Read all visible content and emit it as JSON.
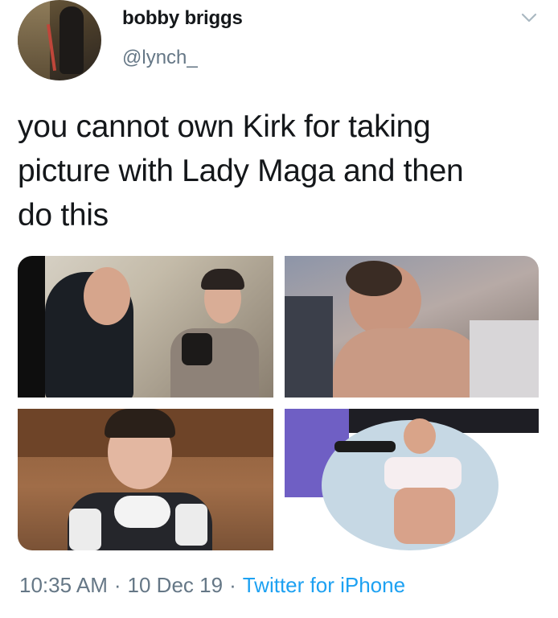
{
  "tweet": {
    "author": {
      "display_name": "bobby briggs",
      "handle": "@lynch_"
    },
    "text_lines": [
      "you cannot own Kirk for taking",
      "picture with Lady Maga and then",
      "do this"
    ],
    "media_count": 4,
    "meta": {
      "time": "10:35 AM",
      "date": "10 Dec 19",
      "separator": "·",
      "source": "Twitter for iPhone"
    }
  },
  "icons": {
    "caret": "chevron-down-icon"
  },
  "colors": {
    "text": "#14171a",
    "secondary": "#657786",
    "link": "#1da1f2"
  }
}
